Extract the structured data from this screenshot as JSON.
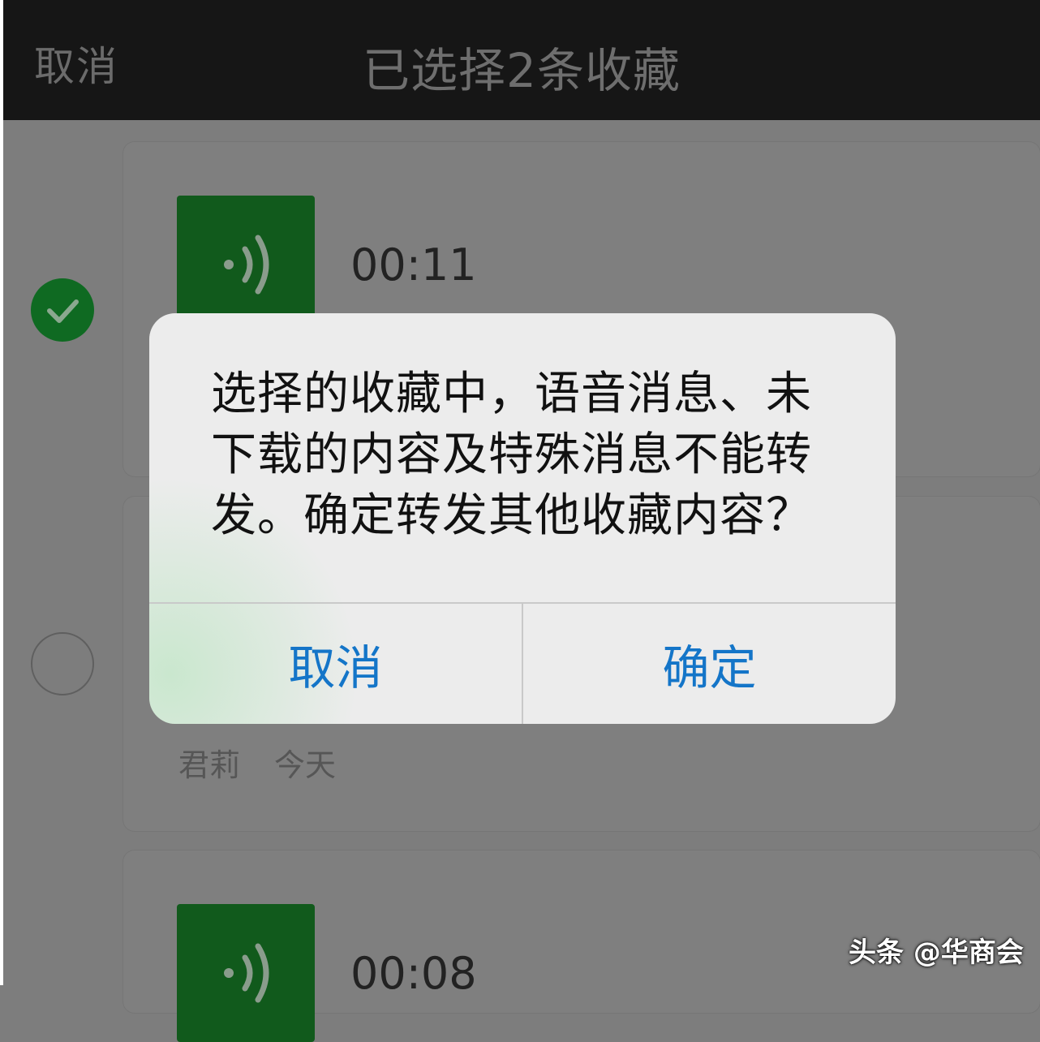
{
  "topbar": {
    "cancel_label": "取消",
    "title": "已选择2条收藏"
  },
  "items": [
    {
      "duration": "00:11",
      "selected": true
    },
    {
      "author": "君莉",
      "date": "今天",
      "selected": false
    },
    {
      "duration": "00:08",
      "selected": false
    }
  ],
  "dialog": {
    "message": "选择的收藏中，语音消息、未下载的内容及特殊消息不能转发。确定转发其他收藏内容？",
    "cancel_label": "取消",
    "confirm_label": "确定"
  },
  "watermark": "头条 @华商会",
  "colors": {
    "accent_blue": "#1475c8",
    "voice_green": "#1f8f32",
    "check_green": "#1aa83a"
  },
  "icons": [
    "voice-icon",
    "checkmark-icon",
    "radio-icon"
  ]
}
